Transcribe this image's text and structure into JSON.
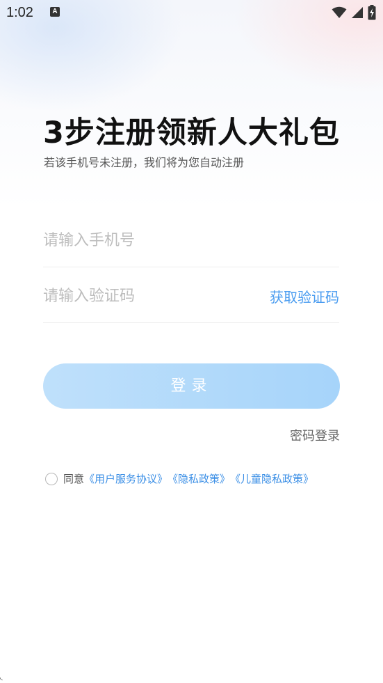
{
  "status_bar": {
    "time": "1:02",
    "notification_icon": "A",
    "icons": [
      "wifi-icon",
      "signal-icon",
      "battery-charging-icon"
    ]
  },
  "header": {
    "title": "3步注册领新人大礼包",
    "subtitle": "若该手机号未注册，我们将为您自动注册"
  },
  "form": {
    "phone_placeholder": "请输入手机号",
    "phone_value": "",
    "code_placeholder": "请输入验证码",
    "code_value": "",
    "get_code_label": "获取验证码",
    "login_label": "登录",
    "password_login_label": "密码登录"
  },
  "agreement": {
    "checked": false,
    "prefix": "同意",
    "links": [
      "《用户服务协议》",
      "《隐私政策》",
      "《儿童隐私政策》"
    ]
  },
  "colors": {
    "accent": "#4a9cf0",
    "button_disabled": "#a6d4fa",
    "link": "#3b8fe6"
  }
}
